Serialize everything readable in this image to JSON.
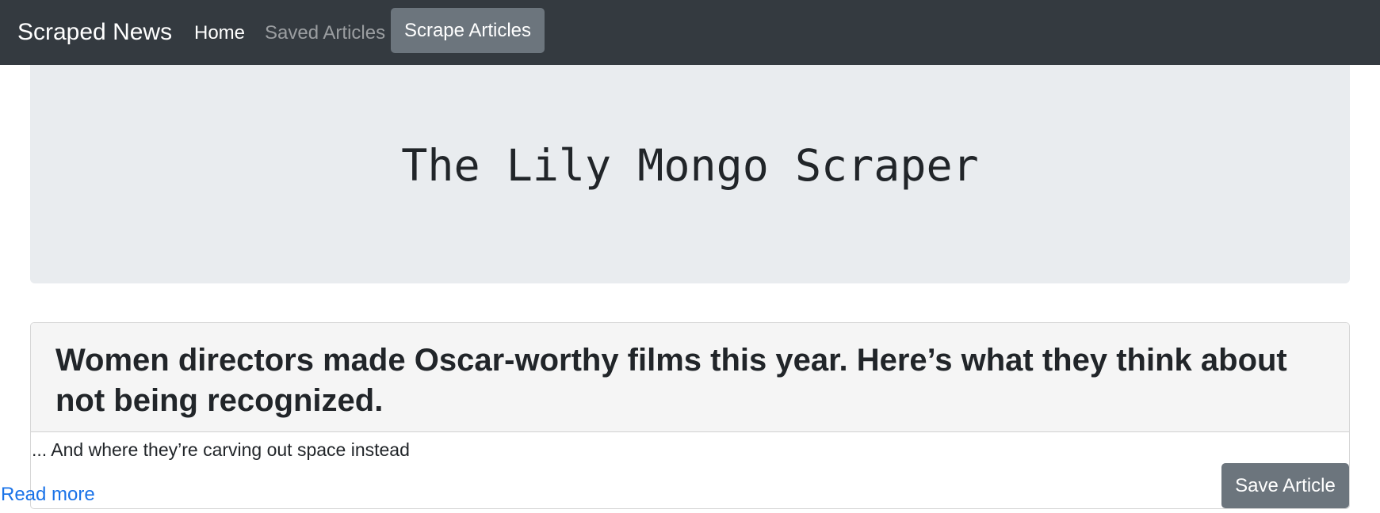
{
  "navbar": {
    "brand": "Scraped News",
    "home_label": "Home",
    "saved_label": "Saved Articles",
    "scrape_label": "Scrape Articles"
  },
  "jumbotron": {
    "title": "The Lily Mongo Scraper"
  },
  "article": {
    "headline": "Women directors made Oscar-worthy films this year. Here’s what they think about not being recognized.",
    "summary": "... And where they’re carving out space instead",
    "read_more_label": "Read more",
    "save_label": "Save Article"
  },
  "colors": {
    "navbar_bg": "#343a40",
    "button_bg": "#6c757d",
    "jumbotron_bg": "#e9ecef",
    "link": "#1a73e8"
  }
}
